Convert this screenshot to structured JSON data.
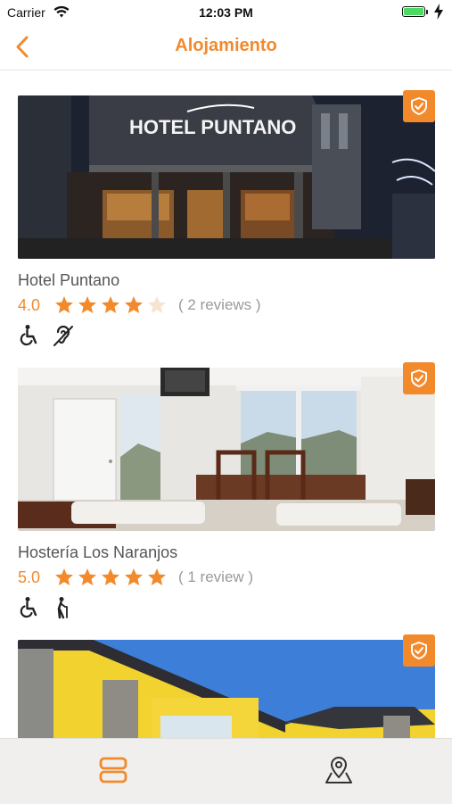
{
  "status_bar": {
    "carrier": "Carrier",
    "time": "12:03 PM",
    "battery_level": 1.0
  },
  "nav": {
    "title": "Alojamiento",
    "back_icon": "chevron-left-icon"
  },
  "colors": {
    "accent": "#f28a2c",
    "star_empty": "#f6e3d0",
    "text": "#555555",
    "muted": "#9a9a9a"
  },
  "listings": [
    {
      "name": "Hotel Puntano",
      "score": "4.0",
      "stars": 4,
      "reviews": "( 2 reviews )",
      "sign_text": "HOTEL PUNTANO",
      "accessibility": [
        "wheelchair-icon",
        "hearing-impaired-icon"
      ]
    },
    {
      "name": "Hostería Los Naranjos",
      "score": "5.0",
      "stars": 5,
      "reviews": "( 1 review )",
      "accessibility": [
        "wheelchair-icon",
        "elderly-icon"
      ]
    },
    {
      "name": "",
      "score": "",
      "stars": 0,
      "reviews": "",
      "accessibility": []
    }
  ],
  "tabs": [
    {
      "icon": "list-icon",
      "active": true
    },
    {
      "icon": "map-pin-icon",
      "active": false
    }
  ]
}
